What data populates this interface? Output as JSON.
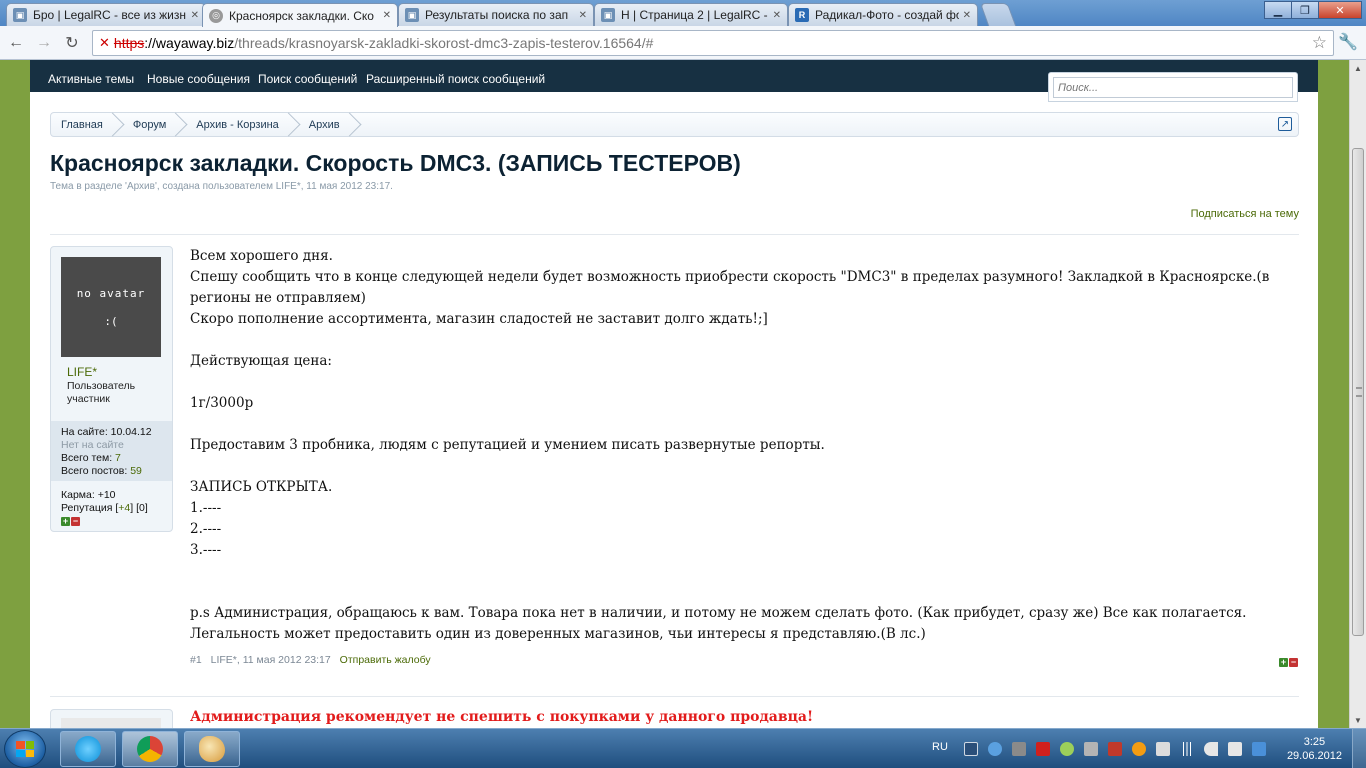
{
  "browser": {
    "tabs": [
      {
        "title": "Бро | LegalRC - все из жизн",
        "active": false
      },
      {
        "title": "Красноярск закладки. Ско",
        "active": true
      },
      {
        "title": "Результаты поиска по зап",
        "active": false
      },
      {
        "title": "Н | Страница 2 | LegalRC - (",
        "active": false
      },
      {
        "title": "Радикал-Фото - создай фо",
        "active": false
      }
    ],
    "url": {
      "scheme": "https",
      "host": "://wayaway.biz",
      "path": "/threads/krasnoyarsk-zakladki-skorost-dmc3-zapis-testerov.16564/#"
    }
  },
  "site_nav": {
    "links": [
      "Активные темы",
      "Новые сообщения",
      "Поиск сообщений",
      "Расширенный поиск сообщений"
    ],
    "search_placeholder": "Поиск..."
  },
  "breadcrumb": [
    "Главная",
    "Форум",
    "Архив - Корзина",
    "Архив"
  ],
  "thread": {
    "title": "Красноярск закладки. Скорость DMC3. (ЗАПИСЬ ТЕСТЕРОВ)",
    "meta": "Тема в разделе 'Архив', создана пользователем LIFE*, 11 мая 2012 23:17.",
    "subscribe": "Подписаться на тему"
  },
  "post": {
    "avatar": {
      "line1": "no avatar",
      "line2": ":("
    },
    "user": {
      "name": "LIFE*",
      "title_line1": "Пользователь",
      "title_line2": "участник",
      "on_site_label": "На сайте:",
      "on_site_date": "10.04.12",
      "offline": "Нет на сайте",
      "threads_label": "Всего тем:",
      "threads_count": "7",
      "posts_label": "Всего постов:",
      "posts_count": "59",
      "karma": "Карма: +10",
      "rep_label": "Репутация [",
      "rep_plus": "+4",
      "rep_rest": "] [0]"
    },
    "lines": [
      "Всем хорошего дня.",
      "Спешу сообщить что в конце следующей недели будет возможность приобрести скорость \"DMC3\" в пределах разумного! Закладкой в Красноярске.(в регионы не отправляем)",
      "Скоро пополнение ассортимента, магазин сладостей не заставит долго ждать!;]",
      "",
      "Действующая цена:",
      "",
      "1г/3000р",
      "",
      "Предоставим 3 пробника, людям с репутацией и умением писать развернутые репорты.",
      "",
      "ЗАПИСЬ ОТКРЫТА.",
      "1.----",
      "2.----",
      "3.----",
      "",
      "",
      "p.s Администрация, обращаюсь к вам. Товара пока нет в наличии, и потому не можем сделать фото. (Как прибудет, сразу же) Все как полагается. Легальность может предоставить один из доверенных магазинов, чьи интересы я представляю.(В лс.)"
    ],
    "footer": {
      "number": "#1",
      "author_date": "LIFE*, 11 мая 2012 23:17",
      "report": "Отправить жалобу"
    }
  },
  "next_post": {
    "warning": "Администрация рекомендует не спешить с покупками у данного продавца!"
  },
  "taskbar": {
    "lang": "RU",
    "time": "3:25",
    "date": "29.06.2012"
  },
  "colors": {
    "link_green": "#4b6a07",
    "nav_dark": "#173042",
    "warning_red": "#e21b1b",
    "page_bg_green": "#7ea040"
  }
}
